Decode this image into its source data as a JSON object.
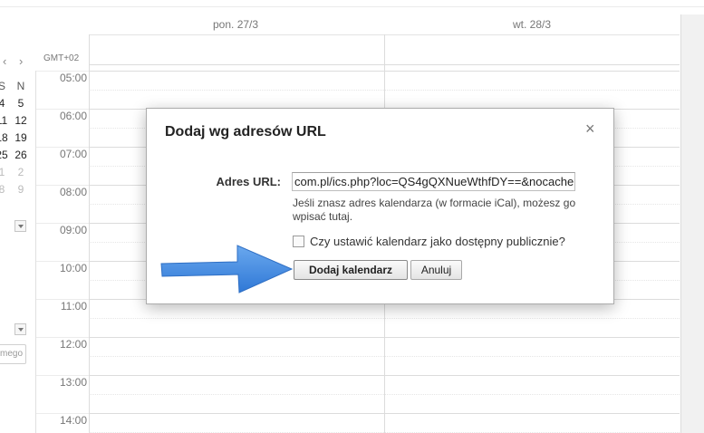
{
  "calendar": {
    "days": [
      "pon. 27/3",
      "wt. 28/3"
    ],
    "timezone": "GMT+02",
    "nav": {
      "prev": "‹",
      "next": "›"
    },
    "mini": {
      "headers": [
        "S",
        "N"
      ],
      "rows": [
        [
          "4",
          "5"
        ],
        [
          "11",
          "12"
        ],
        [
          "18",
          "19"
        ],
        [
          "25",
          "26"
        ],
        [
          "1",
          "2"
        ],
        [
          "8",
          "9"
        ]
      ]
    },
    "hours": [
      "05:00",
      "06:00",
      "07:00",
      "08:00",
      "09:00",
      "10:00",
      "11:00",
      "12:00",
      "13:00",
      "14:00"
    ],
    "other_cal_placeholder": "mego"
  },
  "dialog": {
    "title": "Dodaj wg adresów URL",
    "close_icon": "×",
    "url_label": "Adres URL:",
    "url_value": "com.pl/ics.php?loc=QS4gQXNueWthfDY==&nocache",
    "helper_text": "Jeśli znasz adres kalendarza (w formacie iCal), możesz go wpisać tutaj.",
    "public_checkbox_label": "Czy ustawić kalendarz jako dostępny publicznie?",
    "public_checked": false,
    "add_button": "Dodaj kalendarz",
    "cancel_button": "Anuluj"
  },
  "colors": {
    "arrow": "#4a90e2",
    "grid": "#dcdcdc"
  }
}
